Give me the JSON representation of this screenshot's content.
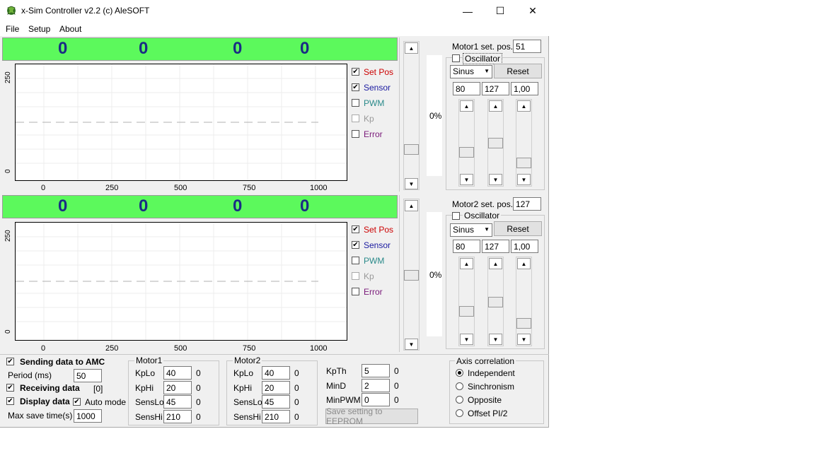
{
  "window": {
    "title": "x-Sim Controller v2.2 (c) AleSOFT",
    "controls": {
      "minimize": "—",
      "maximize": "☐",
      "close": "✕"
    }
  },
  "menu": {
    "file": "File",
    "setup": "Setup",
    "about": "About"
  },
  "motor1_panel": {
    "readouts": [
      "0",
      "0",
      "0",
      "0"
    ],
    "y_ticks": [
      "250",
      "0"
    ],
    "x_ticks": [
      "0",
      "250",
      "500",
      "750",
      "1000"
    ],
    "legend": [
      {
        "label": "Set Pos",
        "checked": true,
        "color": "#cc0000"
      },
      {
        "label": "Sensor",
        "checked": true,
        "color": "#1a1aa0"
      },
      {
        "label": "PWM",
        "checked": false,
        "color": "#2a8a8a"
      },
      {
        "label": "Kp",
        "checked": false,
        "color": "#999999"
      },
      {
        "label": "Error",
        "checked": false,
        "color": "#7a1a7a"
      }
    ],
    "percent": "0%",
    "set_pos_label": "Motor1 set. pos.",
    "set_pos_value": "51",
    "oscillator_label": "Oscillator",
    "waveform": "Sinus",
    "reset_label": "Reset",
    "osc_params": [
      "80",
      "127",
      "1,00"
    ]
  },
  "motor2_panel": {
    "readouts": [
      "0",
      "0",
      "0",
      "0"
    ],
    "y_ticks": [
      "250",
      "0"
    ],
    "x_ticks": [
      "0",
      "250",
      "500",
      "750",
      "1000"
    ],
    "legend": [
      {
        "label": "Set Pos",
        "checked": true,
        "color": "#cc0000"
      },
      {
        "label": "Sensor",
        "checked": true,
        "color": "#1a1aa0"
      },
      {
        "label": "PWM",
        "checked": false,
        "color": "#2a8a8a"
      },
      {
        "label": "Kp",
        "checked": false,
        "color": "#999999"
      },
      {
        "label": "Error",
        "checked": false,
        "color": "#7a1a7a"
      }
    ],
    "percent": "0%",
    "set_pos_label": "Motor2 set. pos.",
    "set_pos_value": "127",
    "oscillator_label": "Oscillator",
    "waveform": "Sinus",
    "reset_label": "Reset",
    "osc_params": [
      "80",
      "127",
      "1,00"
    ]
  },
  "bottom": {
    "sending_label": "Sending data to AMC",
    "period_label": "Period (ms)",
    "period_value": "50",
    "receiving_label": "Receiving data",
    "receiving_count": "[0]",
    "display_label": "Display data",
    "auto_mode_label": "Auto mode",
    "max_save_label": "Max save time(s)",
    "max_save_value": "1000",
    "motor1_group": {
      "title": "Motor1",
      "rows": [
        {
          "label": "KpLo",
          "value": "40",
          "readout": "0"
        },
        {
          "label": "KpHi",
          "value": "20",
          "readout": "0"
        },
        {
          "label": "SensLo",
          "value": "45",
          "readout": "0"
        },
        {
          "label": "SensHi",
          "value": "210",
          "readout": "0"
        }
      ]
    },
    "motor2_group": {
      "title": "Motor2",
      "rows": [
        {
          "label": "KpLo",
          "value": "40",
          "readout": "0"
        },
        {
          "label": "KpHi",
          "value": "20",
          "readout": "0"
        },
        {
          "label": "SensLo",
          "value": "45",
          "readout": "0"
        },
        {
          "label": "SensHi",
          "value": "210",
          "readout": "0"
        }
      ]
    },
    "global_rows": [
      {
        "label": "KpTh",
        "value": "5",
        "readout": "0"
      },
      {
        "label": "MinD",
        "value": "2",
        "readout": "0"
      },
      {
        "label": "MinPWM",
        "value": "0",
        "readout": "0"
      }
    ],
    "save_eeprom_label": "Save setting to EEPROM",
    "axis_group": {
      "title": "Axis correlation",
      "options": [
        "Independent",
        "Sinchronism",
        "Opposite",
        "Offset PI/2"
      ],
      "selected": "Independent"
    }
  }
}
